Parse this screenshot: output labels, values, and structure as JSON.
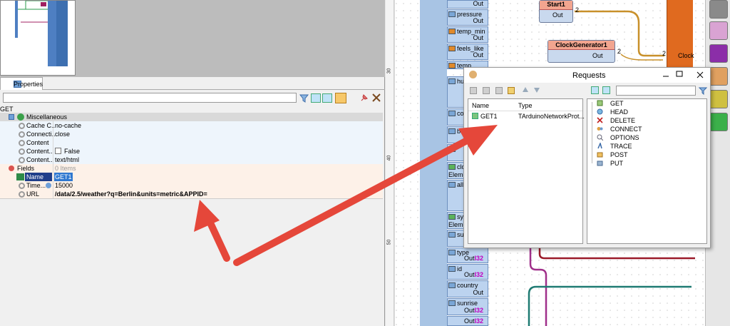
{
  "properties": {
    "tab_label": "Properties",
    "filter_value": "",
    "component_name": "GET",
    "rows": [
      {
        "label": "Miscellaneous",
        "value": ""
      },
      {
        "label": "Cache C..",
        "value": "no-cache"
      },
      {
        "label": "Connecti..",
        "value": "close"
      },
      {
        "label": "Content",
        "value": ""
      },
      {
        "label": "Content..",
        "value": "False"
      },
      {
        "label": "Content..",
        "value": "text/html"
      },
      {
        "label": "Fields",
        "value": "0 Items"
      },
      {
        "label": "Name",
        "value": "GET1"
      },
      {
        "label": "Time...",
        "value": "15000"
      },
      {
        "label": "URL",
        "value": "/data/2.5/weather?q=Berlin&units=metric&APPID="
      }
    ]
  },
  "canvas": {
    "ruler_marks": [
      "30",
      "40",
      "50"
    ],
    "pins": [
      {
        "name": "",
        "out": "Out"
      },
      {
        "name": "pressure",
        "out": "Out"
      },
      {
        "name": "temp_min",
        "out": "Out"
      },
      {
        "name": "feels_like",
        "out": "Out"
      },
      {
        "name": "temp",
        "out": ""
      },
      {
        "name": "hur",
        "out": ""
      },
      {
        "name": "co",
        "out": ""
      },
      {
        "name": "bas",
        "out": ""
      },
      {
        "name": "clo",
        "out": ""
      },
      {
        "name": "Eleme",
        "out": ""
      },
      {
        "name": "all",
        "out": ""
      },
      {
        "name": "sys",
        "out": ""
      },
      {
        "name": "Eleme",
        "out": ""
      },
      {
        "name": "sur",
        "out": ""
      },
      {
        "name": "type",
        "out": "Out"
      },
      {
        "name": "id",
        "out": "Out"
      },
      {
        "name": "country",
        "out": "Out"
      },
      {
        "name": "sunrise",
        "out": "Out"
      },
      {
        "name": "",
        "out": "Out"
      }
    ],
    "pin_type_tag": "I32",
    "start_title": "Start1",
    "start_out": "Out",
    "start_num": "2",
    "clock_title": "ClockGenerator1",
    "clock_out": "Out",
    "clock_num": "2",
    "clock_in_num": "2",
    "clock_in_label": "Clock"
  },
  "dialog": {
    "title": "Requests",
    "filter_value": "",
    "columns": [
      "Name",
      "Type"
    ],
    "rows": [
      {
        "name": "GET1",
        "type": "TArduinoNetworkProt..."
      }
    ],
    "methods": [
      {
        "label": "GET",
        "icon": "get-icon"
      },
      {
        "label": "HEAD",
        "icon": "head-icon"
      },
      {
        "label": "DELETE",
        "icon": "delete-icon"
      },
      {
        "label": "CONNECT",
        "icon": "connect-icon"
      },
      {
        "label": "OPTIONS",
        "icon": "options-icon"
      },
      {
        "label": "TRACE",
        "icon": "trace-icon"
      },
      {
        "label": "POST",
        "icon": "post-icon"
      },
      {
        "label": "PUT",
        "icon": "put-icon"
      }
    ]
  },
  "colors": {
    "arrow": "#e5473a",
    "wire_gold": "#c8902a",
    "wire_red": "#9b1b2a",
    "wire_purple": "#a0308a",
    "wire_teal": "#1e7a72",
    "selection": "#2f78d0"
  }
}
